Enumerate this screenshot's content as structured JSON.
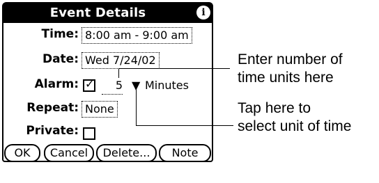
{
  "dialog": {
    "title": "Event Details",
    "info_glyph": "i",
    "labels": {
      "time": "Time:",
      "date": "Date:",
      "alarm": "Alarm:",
      "repeat": "Repeat:",
      "private": "Private:"
    },
    "time_value": "8:00 am - 9:00 am",
    "date_value": "Wed 7/24/02",
    "alarm_checked": true,
    "alarm_check_glyph": "✓",
    "alarm_amount": "5",
    "alarm_unit": "Minutes",
    "dropdown_glyph": "▼",
    "repeat_value": "None",
    "private_checked": false,
    "buttons": {
      "ok": "OK",
      "cancel": "Cancel",
      "delete": "Delete...",
      "note": "Note"
    }
  },
  "callouts": {
    "top": [
      "Enter number of",
      "time units here"
    ],
    "bottom": [
      "Tap here to",
      "select unit of time"
    ]
  }
}
